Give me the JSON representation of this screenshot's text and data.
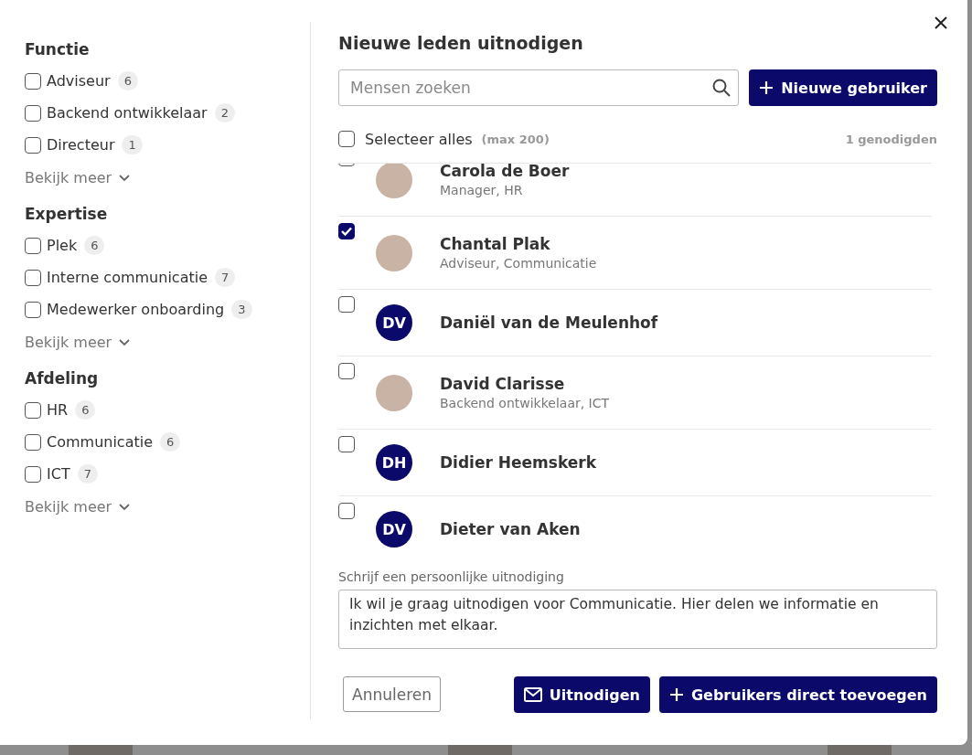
{
  "filters": [
    {
      "title": "Functie",
      "options": [
        {
          "label": "Adviseur",
          "count": "6",
          "checked": false
        },
        {
          "label": "Backend ontwikkelaar",
          "count": "2",
          "checked": false
        },
        {
          "label": "Directeur",
          "count": "1",
          "checked": false
        }
      ],
      "more": "Bekijk meer"
    },
    {
      "title": "Expertise",
      "options": [
        {
          "label": "Plek",
          "count": "6",
          "checked": false
        },
        {
          "label": "Interne communicatie",
          "count": "7",
          "checked": false
        },
        {
          "label": "Medewerker onboarding",
          "count": "3",
          "checked": false
        }
      ],
      "more": "Bekijk meer"
    },
    {
      "title": "Afdeling",
      "options": [
        {
          "label": "HR",
          "count": "6",
          "checked": false
        },
        {
          "label": "Communicatie",
          "count": "6",
          "checked": false
        },
        {
          "label": "ICT",
          "count": "7",
          "checked": false
        }
      ],
      "more": "Bekijk meer"
    }
  ],
  "title": "Nieuwe leden uitnodigen",
  "search": {
    "placeholder": "Mensen zoeken"
  },
  "new_user_button": "Nieuwe gebruiker",
  "select_all": {
    "label": "Selecteer alles",
    "hint": "(max 200)",
    "checked": false
  },
  "invited_count": "1 genodigden",
  "members": [
    {
      "name": "Carola de Boer",
      "subtitle": "Manager, HR",
      "avatar": {
        "kind": "photo"
      },
      "checked": false
    },
    {
      "name": "Chantal Plak",
      "subtitle": "Adviseur, Communicatie",
      "avatar": {
        "kind": "photo"
      },
      "checked": true
    },
    {
      "name": "Daniël van de Meulenhof",
      "avatar": {
        "kind": "initials",
        "initials": "DV"
      },
      "checked": false
    },
    {
      "name": "David Clarisse",
      "subtitle": "Backend ontwikkelaar, ICT",
      "avatar": {
        "kind": "photo"
      },
      "checked": false
    },
    {
      "name": "Didier Heemskerk",
      "avatar": {
        "kind": "initials",
        "initials": "DH"
      },
      "checked": false
    },
    {
      "name": "Dieter van Aken",
      "avatar": {
        "kind": "initials",
        "initials": "DV"
      },
      "checked": false
    }
  ],
  "message": {
    "label": "Schrijf een persoonlijke uitnodiging",
    "value": "Ik wil je graag uitnodigen voor Communicatie. Hier delen we informatie en inzichten met elkaar."
  },
  "buttons": {
    "cancel": "Annuleren",
    "invite": "Uitnodigen",
    "add_direct": "Gebruikers direct toevoegen"
  }
}
